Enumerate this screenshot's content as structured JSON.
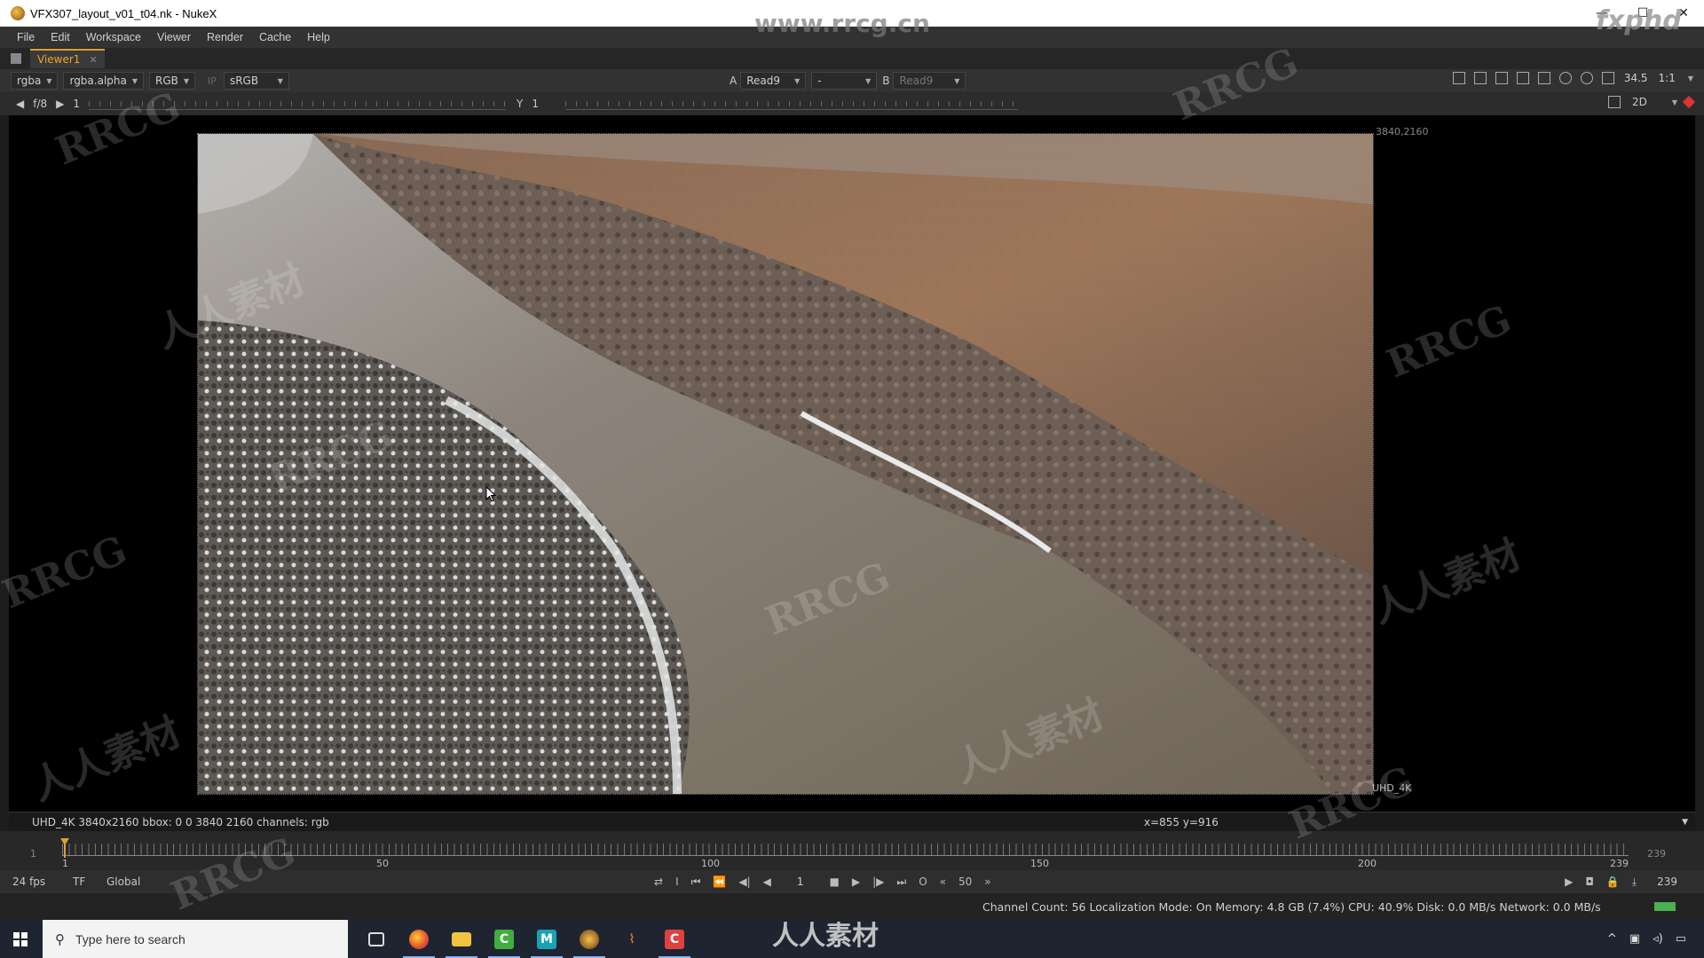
{
  "window": {
    "title": "VFX307_layout_v01_t04.nk - NukeX",
    "minimize": "—",
    "maximize": "☐",
    "close": "✕"
  },
  "menu": [
    "File",
    "Edit",
    "Workspace",
    "Viewer",
    "Render",
    "Cache",
    "Help"
  ],
  "tabs": [
    {
      "label": "Viewer1",
      "close": "✕"
    }
  ],
  "viewer_toolbar": {
    "channels": "rgba",
    "alpha_channel": "rgba.alpha",
    "display_channels": "RGB",
    "ip": "IP",
    "lut": "sRGB",
    "input_a_label": "A",
    "input_a": "Read9",
    "wipe_mode": "-",
    "input_b_label": "B",
    "input_b": "Read9",
    "zoom": "34.5",
    "proxy_ratio": "1:1"
  },
  "viewer_toolbar2": {
    "fstop": "f/8",
    "gain": "1",
    "gamma_label": "Y",
    "gamma": "1",
    "view_mode": "2D"
  },
  "viewer": {
    "format_top_right": "3840,2160",
    "format_bottom_right": "UHD_4K"
  },
  "info": {
    "left": "UHD_4K 3840x2160  bbox: 0 0 3840 2160 channels: rgb",
    "right": "x=855 y=916"
  },
  "timeline": {
    "start_frame": "1",
    "end_frame": "239",
    "ticks": [
      "1",
      "50",
      "100",
      "150",
      "200",
      "239"
    ]
  },
  "playback": {
    "fps": "24 fps",
    "time_format": "TF",
    "range_mode": "Global",
    "current_frame": "1",
    "step": "50",
    "end_frame": "239"
  },
  "status": {
    "text": "Channel Count: 56 Localization Mode: On Memory: 4.8 GB (7.4%) CPU: 40.9% Disk: 0.0 MB/s Network: 0.0 MB/s"
  },
  "taskbar": {
    "search_placeholder": "Type here to search",
    "apps": [
      "task-view",
      "firefox",
      "file-explorer",
      "camtasia",
      "maya",
      "nuke",
      "unreal",
      "camtasia-recorder"
    ]
  },
  "watermarks": {
    "url": "www.rrcg.cn",
    "brand": "fxphd",
    "logo": "RRCG",
    "cn": "人人素材",
    "bottom": "人人素材"
  }
}
